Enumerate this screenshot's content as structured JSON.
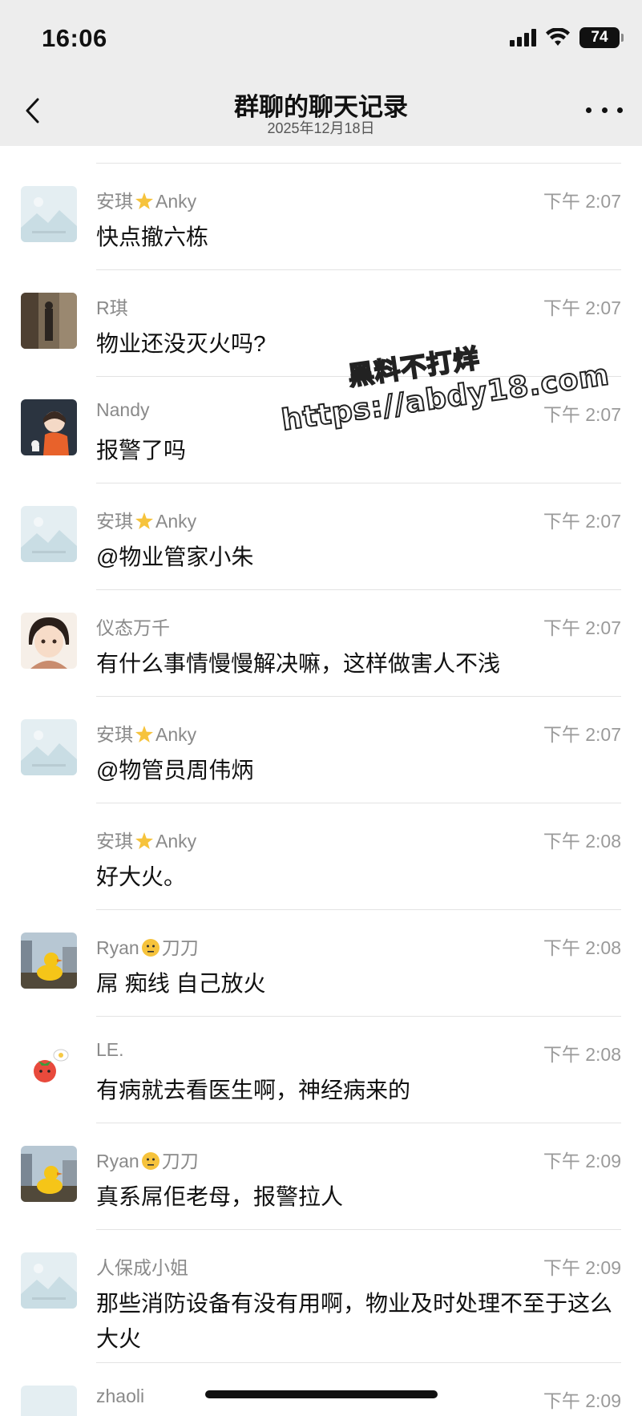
{
  "status": {
    "time": "16:06",
    "battery": "74"
  },
  "header": {
    "title": "群聊的聊天记录",
    "date": "2025年12月18日"
  },
  "watermark": {
    "line1": "黑料不打烊",
    "line2": "https://abdy18.com"
  },
  "messages": [
    {
      "sender": "安琪",
      "sender_suffix": "Anky",
      "time": "下午 2:07",
      "content": "快点撤六栋"
    },
    {
      "sender": "R琪",
      "sender_suffix": "",
      "time": "下午 2:07",
      "content": "物业还没灭火吗?"
    },
    {
      "sender": "Nandy",
      "sender_suffix": "",
      "time": "下午 2:07",
      "content": "报警了吗"
    },
    {
      "sender": "安琪",
      "sender_suffix": "Anky",
      "time": "下午 2:07",
      "content": "@物业管家小朱"
    },
    {
      "sender": "仪态万千",
      "sender_suffix": "",
      "time": "下午 2:07",
      "content": "有什么事情慢慢解决嘛，这样做害人不浅"
    },
    {
      "sender": "安琪",
      "sender_suffix": "Anky",
      "time": "下午 2:07",
      "content": "@物管员周伟炳"
    },
    {
      "sender": "安琪",
      "sender_suffix": "Anky",
      "time": "下午 2:08",
      "content": "好大火。"
    },
    {
      "sender": "Ryan",
      "sender_suffix": "刀刀",
      "time": "下午 2:08",
      "content": "屌 痴线 自己放火"
    },
    {
      "sender": "LE.",
      "sender_suffix": "",
      "time": "下午 2:08",
      "content": "有病就去看医生啊，神经病来的"
    },
    {
      "sender": "Ryan",
      "sender_suffix": "刀刀",
      "time": "下午 2:09",
      "content": "真系屌佢老母，报警拉人"
    },
    {
      "sender": "人保成小姐",
      "sender_suffix": "",
      "time": "下午 2:09",
      "content": "那些消防设备有没有用啊，物业及时处理不至于这么大火"
    },
    {
      "sender": "zhaoli",
      "sender_suffix": "",
      "time": "下午 2:09",
      "content": ""
    }
  ]
}
